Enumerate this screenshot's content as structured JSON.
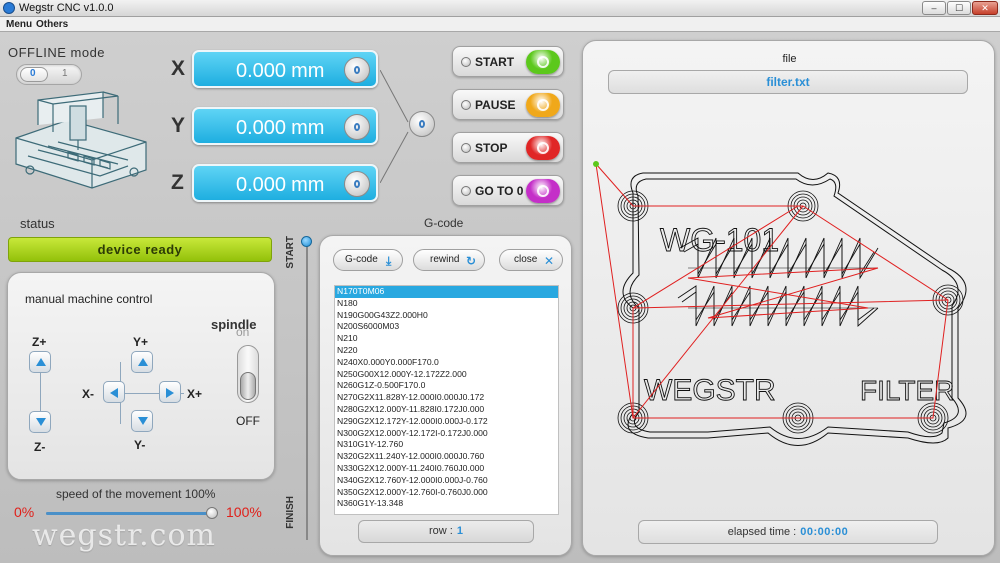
{
  "window": {
    "title": "Wegstr CNC  v1.0.0",
    "min": "–",
    "max": "☐",
    "close": "✕"
  },
  "menu": {
    "items": [
      "Menu",
      "Others"
    ]
  },
  "offline": {
    "label": "OFFLINE mode",
    "opt0": "0",
    "opt1": "1"
  },
  "axes": {
    "x": {
      "letter": "X",
      "value": "0.000",
      "unit": "mm"
    },
    "y": {
      "letter": "Y",
      "value": "0.000",
      "unit": "mm"
    },
    "z": {
      "letter": "Z",
      "value": "0.000",
      "unit": "mm"
    }
  },
  "controls": {
    "start": {
      "label": "START",
      "color": "#5cc81c"
    },
    "pause": {
      "label": "PAUSE",
      "color": "#f0a81a"
    },
    "stop": {
      "label": "STOP",
      "color": "#e02626"
    },
    "goto0": {
      "label": "GO TO 0",
      "color": "#c42fc8"
    }
  },
  "status": {
    "label": "status",
    "text": "device ready"
  },
  "manual": {
    "title": "manual machine control",
    "zplus": "Z+",
    "zminus": "Z-",
    "yplus": "Y+",
    "yminus": "Y-",
    "xminus": "X-",
    "xplus": "X+",
    "spindle": "spindle",
    "on": "on",
    "off": "OFF"
  },
  "speed": {
    "label": "speed of the movement 100%",
    "min": "0%",
    "max": "100%",
    "value": 100
  },
  "brand": "wegstr.com",
  "progress": {
    "start": "START",
    "finish": "FINISH",
    "value": 0
  },
  "gcode": {
    "label": "G-code",
    "load_btn": "G-code",
    "rewind_btn": "rewind",
    "close_btn": "close",
    "lines": [
      "N170T0M06",
      "N180",
      "N190G00G43Z2.000H0",
      "N200S6000M03",
      "N210",
      "N220",
      "N240X0.000Y0.000F170.0",
      "N250G00X12.000Y-12.172Z2.000",
      "N260G1Z-0.500F170.0",
      "N270G2X11.828Y-12.000I0.000J0.172",
      "N280G2X12.000Y-11.828I0.172J0.000",
      "N290G2X12.172Y-12.000I0.000J-0.172",
      "N300G2X12.000Y-12.172I-0.172J0.000",
      "N310G1Y-12.760",
      "N320G2X11.240Y-12.000I0.000J0.760",
      "N330G2X12.000Y-11.240I0.760J0.000",
      "N340G2X12.760Y-12.000I0.000J-0.760",
      "N350G2X12.000Y-12.760I-0.760J0.000",
      "N360G1Y-13.348"
    ],
    "selected_index": 0,
    "row_label": "row :",
    "row_value": "1"
  },
  "file": {
    "label": "file",
    "name": "filter.txt",
    "preview_text_top": "WG-101",
    "preview_text_left": "WEGSTR",
    "preview_text_right": "FILTER",
    "elapsed_label": "elapsed time :",
    "elapsed_value": "00:00:00"
  }
}
